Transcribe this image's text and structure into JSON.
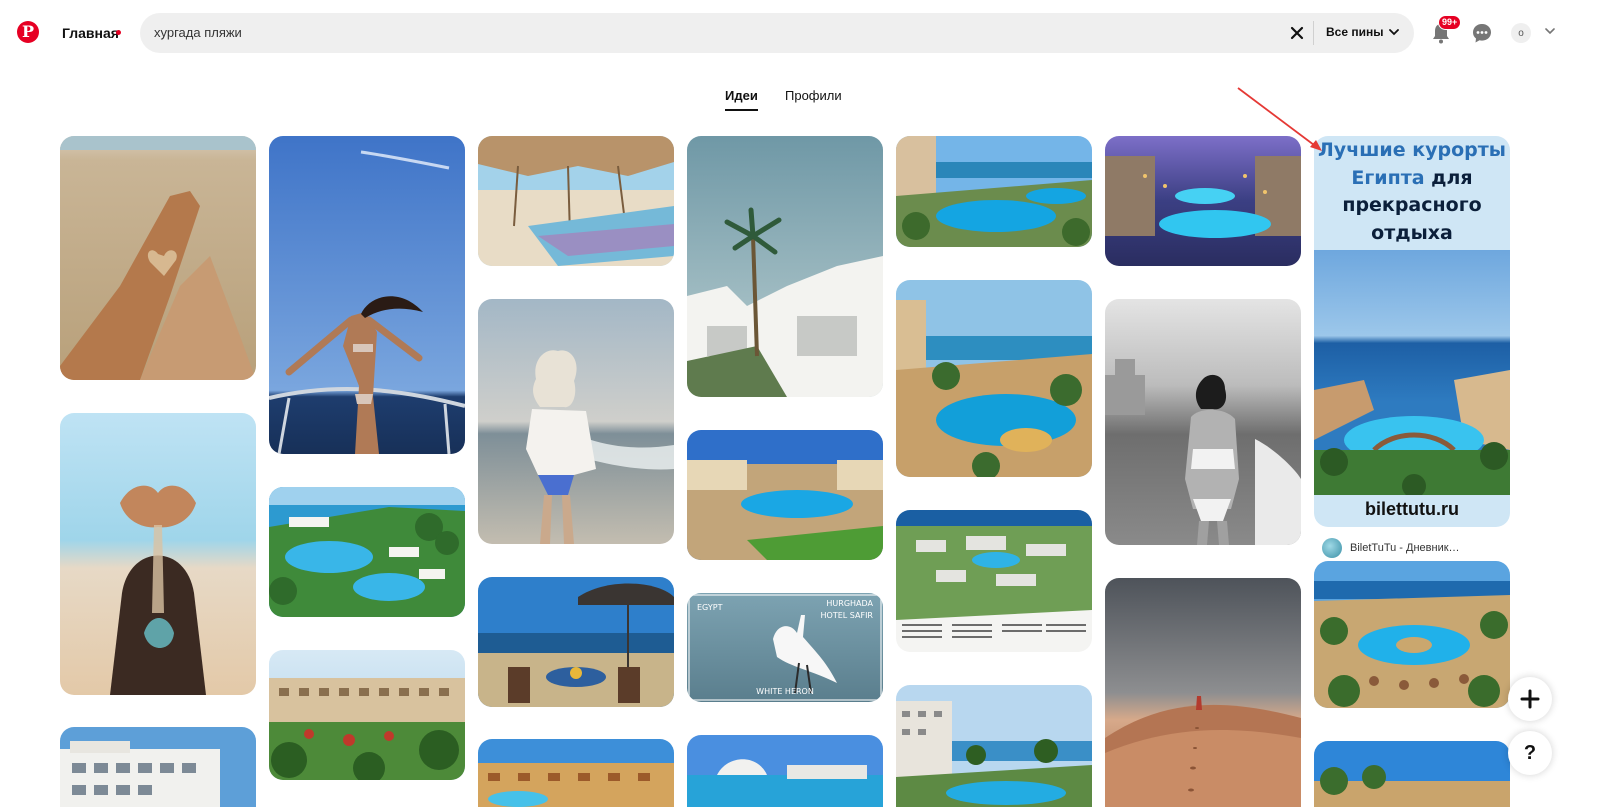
{
  "header": {
    "logo_icon": "pinterest-logo",
    "home_label": "Главная",
    "search_value": "хургада пляжи",
    "filter_label": "Все пины",
    "notification_count": "99+",
    "avatar_letter": "o"
  },
  "tabs": [
    {
      "label": "Идеи",
      "active": true
    },
    {
      "label": "Профили",
      "active": false
    }
  ],
  "ad": {
    "title_part1": "Лучшие курорты",
    "title_part2_highlight": "Египта",
    "title_part3": "для",
    "title_line3": "прекрасного",
    "title_line4": "отдыха",
    "site": "bilettutu.ru",
    "author": "BiletTuTu - Дневник…"
  },
  "pins": [
    {
      "photo": "sand-legs-heart"
    },
    {
      "photo": "woman-hands-sand"
    },
    {
      "photo": "hotel-building"
    },
    {
      "photo": "woman-boat-sky"
    },
    {
      "photo": "resort-pools-aerial"
    },
    {
      "photo": "resort-hotel-garden"
    },
    {
      "photo": "beach-umbrellas"
    },
    {
      "photo": "woman-beach-sunset"
    },
    {
      "photo": "beach-terrace-table"
    },
    {
      "photo": "resort-pool-aerial-2"
    },
    {
      "photo": "white-villas-palms"
    },
    {
      "photo": "resort-aerial-pool"
    },
    {
      "photo": "white-heron-egypt"
    },
    {
      "photo": "resort-harbor"
    },
    {
      "photo": "resort-marina-pools"
    },
    {
      "photo": "resort-marina-pools-2"
    },
    {
      "photo": "resort-map"
    },
    {
      "photo": "resort-palms-pool"
    },
    {
      "photo": "resort-night-pool"
    },
    {
      "photo": "woman-bw-beach"
    },
    {
      "photo": "desert-dunes"
    },
    {
      "photo": "resort-lagoon-pool"
    },
    {
      "photo": "resort-beach-bottom"
    }
  ],
  "heron_card": {
    "left_text": "EGYPT",
    "right_line1": "HURGHADA",
    "right_line2": "HOTEL SAFIR",
    "bottom_text": "WHITE HERON"
  },
  "colors": {
    "brand_red": "#e60023",
    "ad_blue": "#2a6fb5"
  }
}
